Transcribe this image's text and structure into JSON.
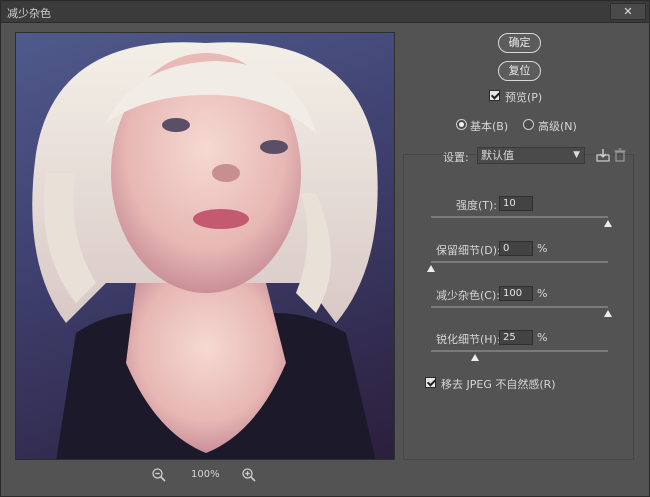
{
  "window": {
    "title": "减少杂色",
    "close": "✕"
  },
  "buttons": {
    "ok": "确定",
    "reset": "复位"
  },
  "preview_toggle": {
    "label": "预览(P)",
    "checked": true
  },
  "mode": {
    "basic": "基本(B)",
    "advanced": "高级(N)",
    "selected": "basic"
  },
  "settings": {
    "label": "设置:",
    "value": "默认值"
  },
  "controls": [
    {
      "label": "强度(T):",
      "value": "10",
      "unit": "",
      "fraction": 1.0
    },
    {
      "label": "保留细节(D):",
      "value": "0",
      "unit": "%",
      "fraction": 0.0
    },
    {
      "label": "减少杂色(C):",
      "value": "100",
      "unit": "%",
      "fraction": 1.0
    },
    {
      "label": "锐化细节(H):",
      "value": "25",
      "unit": "%",
      "fraction": 0.25
    }
  ],
  "jpeg_toggle": {
    "label": "移去 JPEG 不自然感(R)",
    "checked": true
  },
  "zoom": {
    "value": "100%"
  }
}
